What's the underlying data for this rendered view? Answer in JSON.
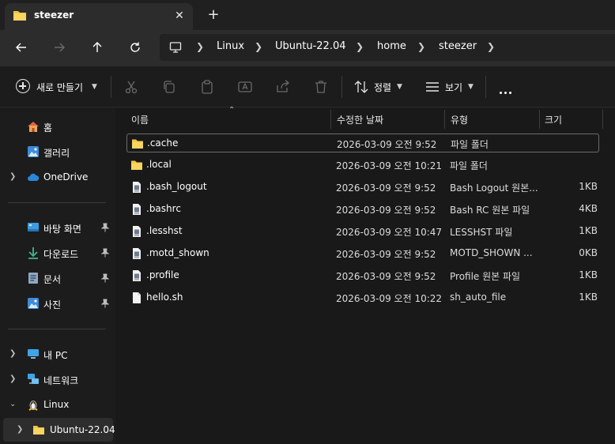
{
  "tab": {
    "title": "steezer"
  },
  "breadcrumb": [
    "Linux",
    "Ubuntu-22.04",
    "home",
    "steezer"
  ],
  "toolbar": {
    "new_label": "새로 만들기",
    "sort_label": "정렬",
    "view_label": "보기"
  },
  "sidebar": {
    "top": [
      {
        "label": "홈",
        "icon": "home-icon"
      },
      {
        "label": "갤러리",
        "icon": "gallery-icon"
      },
      {
        "label": "OneDrive",
        "icon": "cloud-icon"
      }
    ],
    "quick": [
      {
        "label": "바탕 화면",
        "icon": "desktop-icon"
      },
      {
        "label": "다운로드",
        "icon": "download-icon"
      },
      {
        "label": "문서",
        "icon": "document-icon"
      },
      {
        "label": "사진",
        "icon": "pictures-icon"
      }
    ],
    "bottom": [
      {
        "label": "내 PC",
        "icon": "pc-icon"
      },
      {
        "label": "네트워크",
        "icon": "network-icon"
      },
      {
        "label": "Linux",
        "icon": "linux-icon"
      },
      {
        "label": "Ubuntu-22.04",
        "icon": "folder-icon"
      }
    ]
  },
  "columns": {
    "name": "이름",
    "date": "수정한 날짜",
    "type": "유형",
    "size": "크기"
  },
  "files": [
    {
      "name": ".cache",
      "date": "2026-03-09 오전 9:52",
      "type": "파일 폴더",
      "size": "",
      "kind": "folder"
    },
    {
      "name": ".local",
      "date": "2026-03-09 오전 10:21",
      "type": "파일 폴더",
      "size": "",
      "kind": "folder"
    },
    {
      "name": ".bash_logout",
      "date": "2026-03-09 오전 9:52",
      "type": "Bash Logout 원본...",
      "size": "1KB",
      "kind": "file"
    },
    {
      "name": ".bashrc",
      "date": "2026-03-09 오전 9:52",
      "type": "Bash RC 원본 파일",
      "size": "4KB",
      "kind": "file"
    },
    {
      "name": ".lesshst",
      "date": "2026-03-09 오전 10:47",
      "type": "LESSHST 파일",
      "size": "1KB",
      "kind": "file"
    },
    {
      "name": ".motd_shown",
      "date": "2026-03-09 오전 9:52",
      "type": "MOTD_SHOWN ...",
      "size": "0KB",
      "kind": "file"
    },
    {
      "name": ".profile",
      "date": "2026-03-09 오전 9:52",
      "type": "Profile 원본 파일",
      "size": "1KB",
      "kind": "file"
    },
    {
      "name": "hello.sh",
      "date": "2026-03-09 오전 10:22",
      "type": "sh_auto_file",
      "size": "1KB",
      "kind": "blank"
    }
  ],
  "colors": {
    "folder": "#f4c542",
    "accent": "#4cc2ff"
  }
}
